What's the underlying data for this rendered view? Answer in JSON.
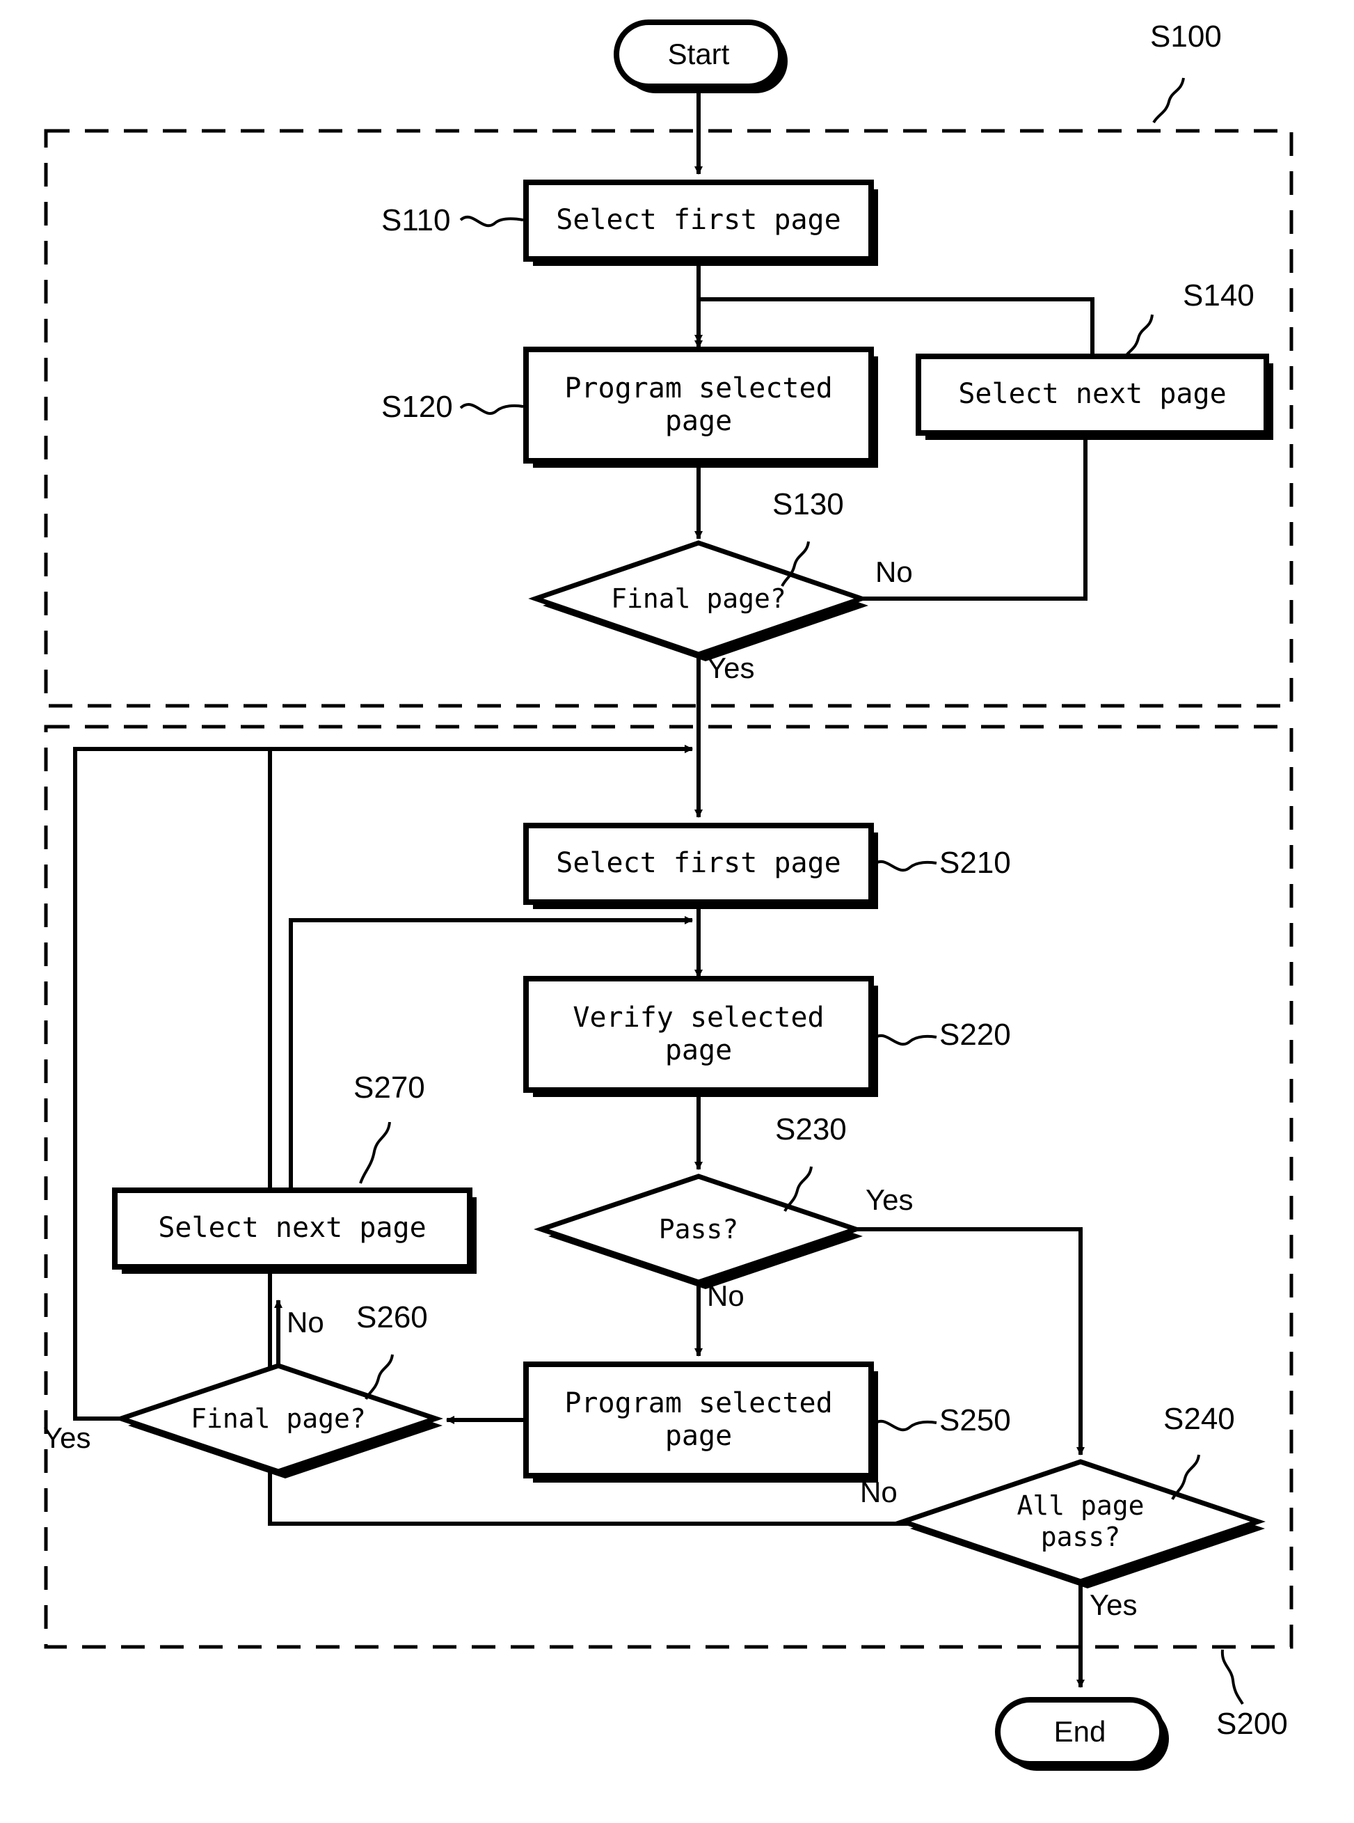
{
  "diagram": {
    "title": "Program and verify flowchart",
    "type": "flowchart",
    "stroke_color": "#000000",
    "fill_color": "#ffffff",
    "groups": [
      {
        "id": "S100",
        "label": "S100",
        "role": "program-phase-group"
      },
      {
        "id": "S200",
        "label": "S200",
        "role": "verify-phase-group"
      }
    ],
    "nodes": {
      "start": {
        "label": "Start",
        "shape": "terminator"
      },
      "s110": {
        "label": "Select first page",
        "shape": "process",
        "ref": "S110"
      },
      "s120": {
        "label": "Program selected\npage",
        "shape": "process",
        "ref": "S120"
      },
      "s130": {
        "label": "Final page?",
        "shape": "decision",
        "ref": "S130"
      },
      "s140": {
        "label": "Select next page",
        "shape": "process",
        "ref": "S140"
      },
      "s210": {
        "label": "Select first page",
        "shape": "process",
        "ref": "S210"
      },
      "s220": {
        "label": "Verify selected\npage",
        "shape": "process",
        "ref": "S220"
      },
      "s230": {
        "label": "Pass?",
        "shape": "decision",
        "ref": "S230"
      },
      "s240": {
        "label": "All page\npass?",
        "shape": "decision",
        "ref": "S240"
      },
      "s250": {
        "label": "Program selected\npage",
        "shape": "process",
        "ref": "S250"
      },
      "s260": {
        "label": "Final page?",
        "shape": "decision",
        "ref": "S260"
      },
      "s270": {
        "label": "Select next page",
        "shape": "process",
        "ref": "S270"
      },
      "end": {
        "label": "End",
        "shape": "terminator"
      }
    },
    "edge_labels": {
      "s130_no": "No",
      "s130_yes": "Yes",
      "s230_yes": "Yes",
      "s230_no": "No",
      "s260_no": "No",
      "s260_yes": "Yes",
      "s240_no": "No",
      "s240_yes": "Yes"
    },
    "refs": {
      "s100": "S100",
      "s110": "S110",
      "s120": "S120",
      "s130": "S130",
      "s140": "S140",
      "s200": "S200",
      "s210": "S210",
      "s220": "S220",
      "s230": "S230",
      "s240": "S240",
      "s250": "S250",
      "s260": "S260",
      "s270": "S270"
    }
  }
}
